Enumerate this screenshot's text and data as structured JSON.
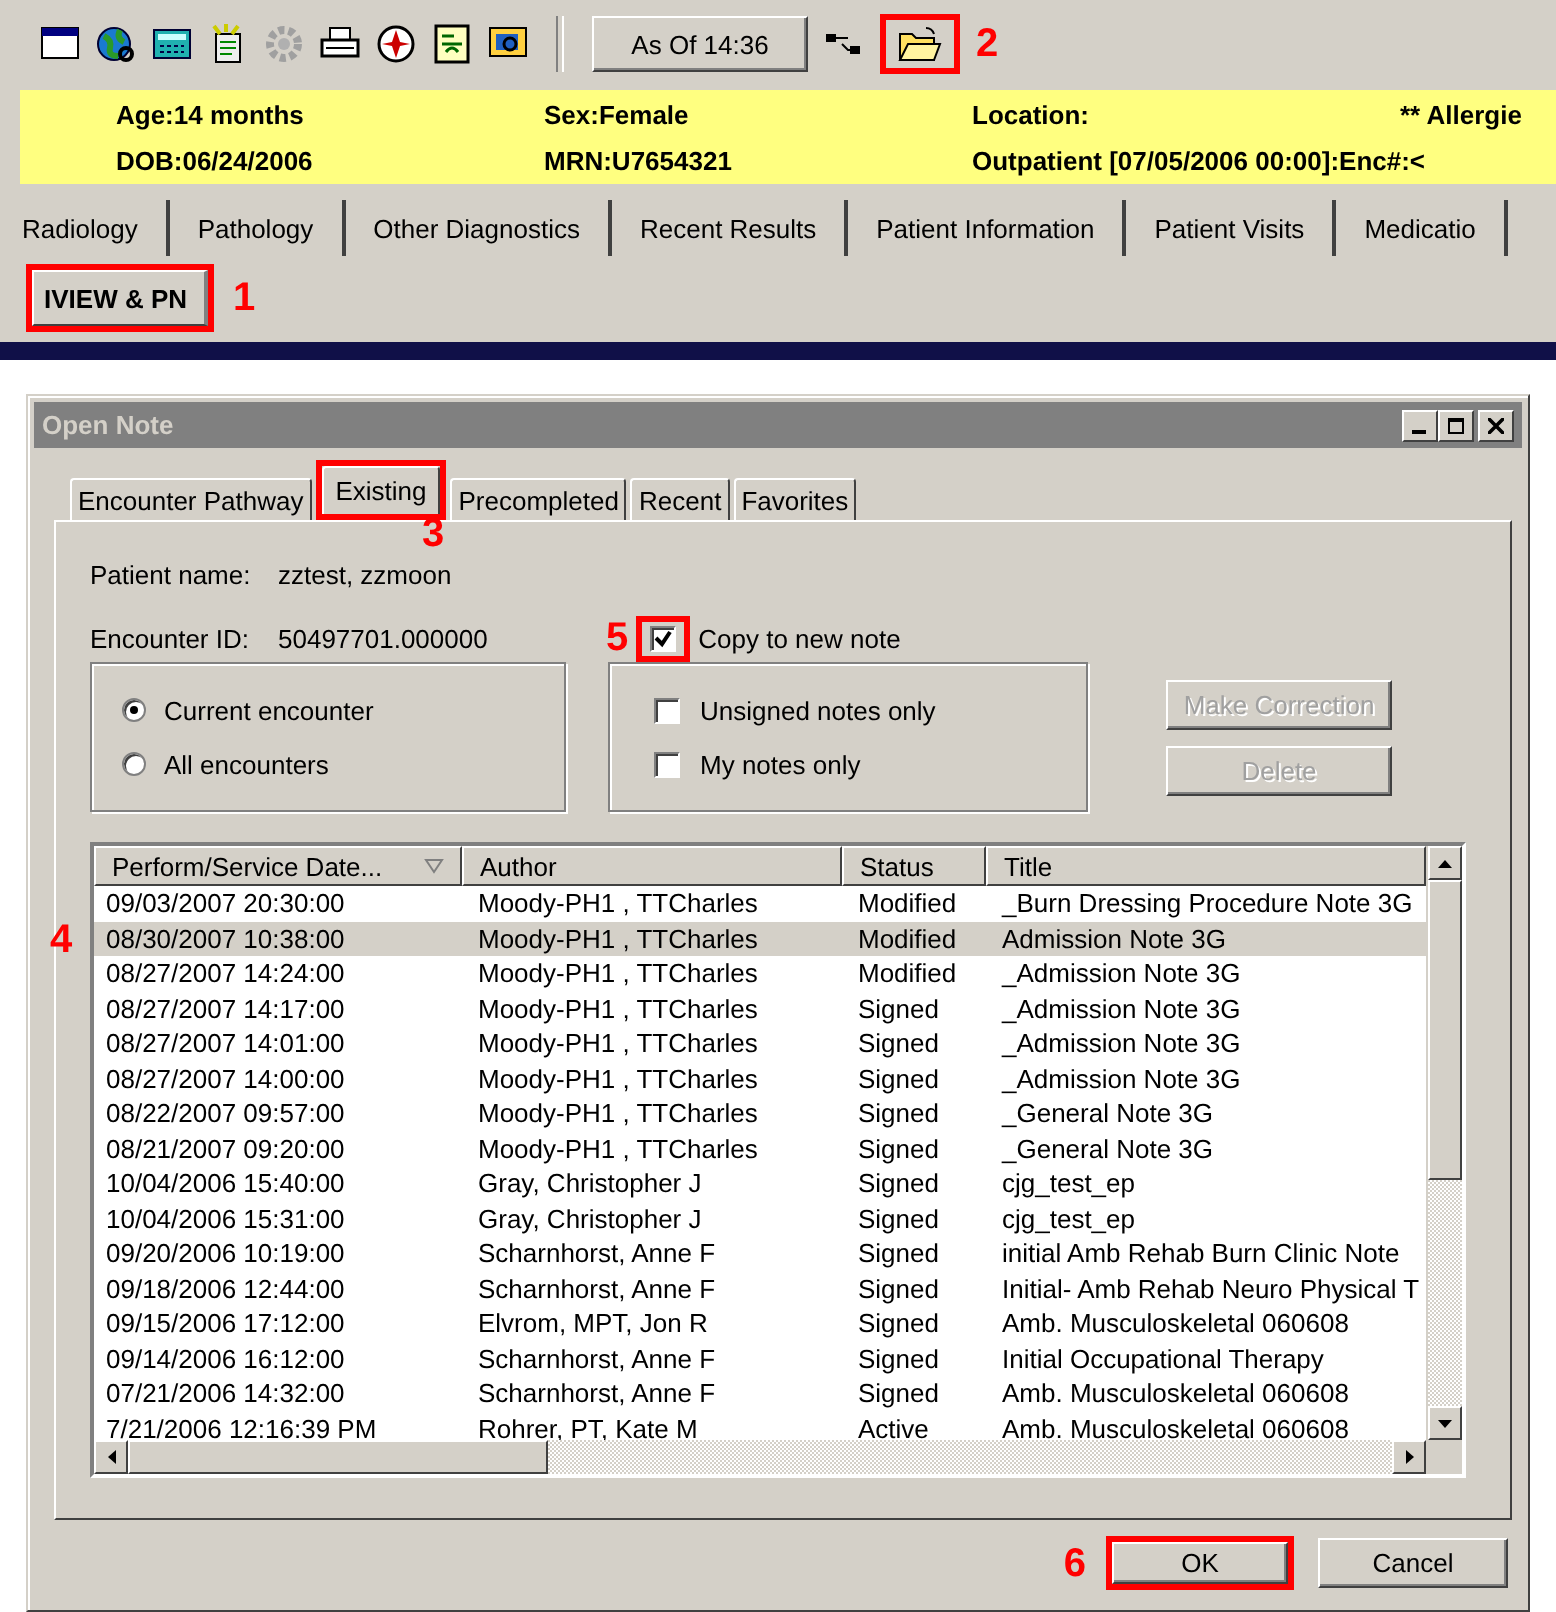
{
  "toolbar": {
    "as_of_button": "As Of 14:36",
    "open_button": {
      "highlighted": true,
      "callout": "2"
    }
  },
  "banner": {
    "rows": [
      [
        "Age:14 months",
        "Sex:Female",
        "Location:",
        "** Allergie"
      ],
      [
        "DOB:06/24/2006",
        "MRN:U7654321",
        "Outpatient [07/05/2006 00:00]:Enc#:<"
      ]
    ]
  },
  "tabs": [
    {
      "label": "Radiology",
      "selected": false
    },
    {
      "label": "Pathology",
      "selected": false
    },
    {
      "label": "Other Diagnostics",
      "selected": false
    },
    {
      "label": "Recent Results",
      "selected": false
    },
    {
      "label": "Patient Information",
      "selected": false
    },
    {
      "label": "Patient Visits",
      "selected": false
    },
    {
      "label": "Medicatio",
      "selected": false
    }
  ],
  "view_tabs": [
    {
      "label": "IVIEW & PN",
      "selected": true,
      "highlighted": true,
      "callout": "1"
    }
  ],
  "dialog": {
    "title": "Open Note",
    "tabs": [
      {
        "label": "Encounter Pathway",
        "selected": false,
        "highlighted": false
      },
      {
        "label": "Existing",
        "selected": true,
        "highlighted": true,
        "callout": "3"
      },
      {
        "label": "Precompleted",
        "selected": false,
        "highlighted": false
      },
      {
        "label": "Recent",
        "selected": false,
        "highlighted": false
      },
      {
        "label": "Favorites",
        "selected": false,
        "highlighted": false
      }
    ],
    "patient_name": {
      "label": "Patient name:",
      "value": "zztest, zzmoon"
    },
    "encounter_id": {
      "label": "Encounter ID:",
      "value": "50497701.000000"
    },
    "copy_option": {
      "label": "Copy to new note",
      "checked": true,
      "highlighted": true,
      "callout": "5"
    },
    "encounter_options": [
      {
        "label": "Current encounter",
        "selected": true
      },
      {
        "label": "All encounters",
        "selected": false
      }
    ],
    "filters": [
      {
        "label": "Unsigned notes only",
        "checked": false
      },
      {
        "label": "My notes only",
        "checked": false
      }
    ],
    "side_buttons": [
      {
        "label": "Make Correction",
        "disabled": true
      },
      {
        "label": "Delete",
        "disabled": true
      }
    ],
    "notes": {
      "columns": [
        "Perform/Service Date...",
        "Author",
        "Status",
        "Title"
      ],
      "rows": [
        {
          "cells": [
            "09/03/2007 20:30:00",
            "Moody-PH1 , TTCharles",
            "Modified",
            "_Burn Dressing Procedure Note 3G"
          ],
          "selected": false
        },
        {
          "cells": [
            "08/30/2007 10:38:00",
            "Moody-PH1 , TTCharles",
            "Modified",
            "Admission Note 3G"
          ],
          "selected": true,
          "callout": "4"
        },
        {
          "cells": [
            "08/27/2007 14:24:00",
            "Moody-PH1 , TTCharles",
            "Modified",
            "_Admission Note 3G"
          ],
          "selected": false
        },
        {
          "cells": [
            "08/27/2007 14:17:00",
            "Moody-PH1 , TTCharles",
            "Signed",
            "_Admission Note 3G"
          ],
          "selected": false
        },
        {
          "cells": [
            "08/27/2007 14:01:00",
            "Moody-PH1 , TTCharles",
            "Signed",
            "_Admission Note 3G"
          ],
          "selected": false
        },
        {
          "cells": [
            "08/27/2007 14:00:00",
            "Moody-PH1 , TTCharles",
            "Signed",
            "_Admission Note 3G"
          ],
          "selected": false
        },
        {
          "cells": [
            "08/22/2007 09:57:00",
            "Moody-PH1 , TTCharles",
            "Signed",
            "_General Note 3G"
          ],
          "selected": false
        },
        {
          "cells": [
            "08/21/2007 09:20:00",
            "Moody-PH1 , TTCharles",
            "Signed",
            "_General Note 3G"
          ],
          "selected": false
        },
        {
          "cells": [
            "10/04/2006 15:40:00",
            "Gray, Christopher J",
            "Signed",
            "cjg_test_ep"
          ],
          "selected": false
        },
        {
          "cells": [
            "10/04/2006 15:31:00",
            "Gray, Christopher J",
            "Signed",
            "cjg_test_ep"
          ],
          "selected": false
        },
        {
          "cells": [
            "09/20/2006 10:19:00",
            "Scharnhorst, Anne F",
            "Signed",
            "initial Amb Rehab Burn Clinic Note"
          ],
          "selected": false
        },
        {
          "cells": [
            "09/18/2006 12:44:00",
            "Scharnhorst, Anne F",
            "Signed",
            "Initial- Amb Rehab Neuro Physical T"
          ],
          "selected": false
        },
        {
          "cells": [
            "09/15/2006 17:12:00",
            "Elvrom, MPT, Jon R",
            "Signed",
            "Amb. Musculoskeletal 060608"
          ],
          "selected": false
        },
        {
          "cells": [
            "09/14/2006 16:12:00",
            "Scharnhorst, Anne F",
            "Signed",
            "Initial  Occupational Therapy"
          ],
          "selected": false
        },
        {
          "cells": [
            "07/21/2006 14:32:00",
            "Scharnhorst, Anne F",
            "Signed",
            "Amb. Musculoskeletal 060608"
          ],
          "selected": false
        },
        {
          "cells": [
            "7/21/2006 12:16:39 PM",
            "Rohrer, PT, Kate M",
            "Active",
            "Amb. Musculoskeletal 060608"
          ],
          "selected": false
        }
      ]
    },
    "buttons": [
      {
        "label": "OK",
        "highlighted": true,
        "callout": "6"
      },
      {
        "label": "Cancel",
        "highlighted": false
      }
    ]
  }
}
